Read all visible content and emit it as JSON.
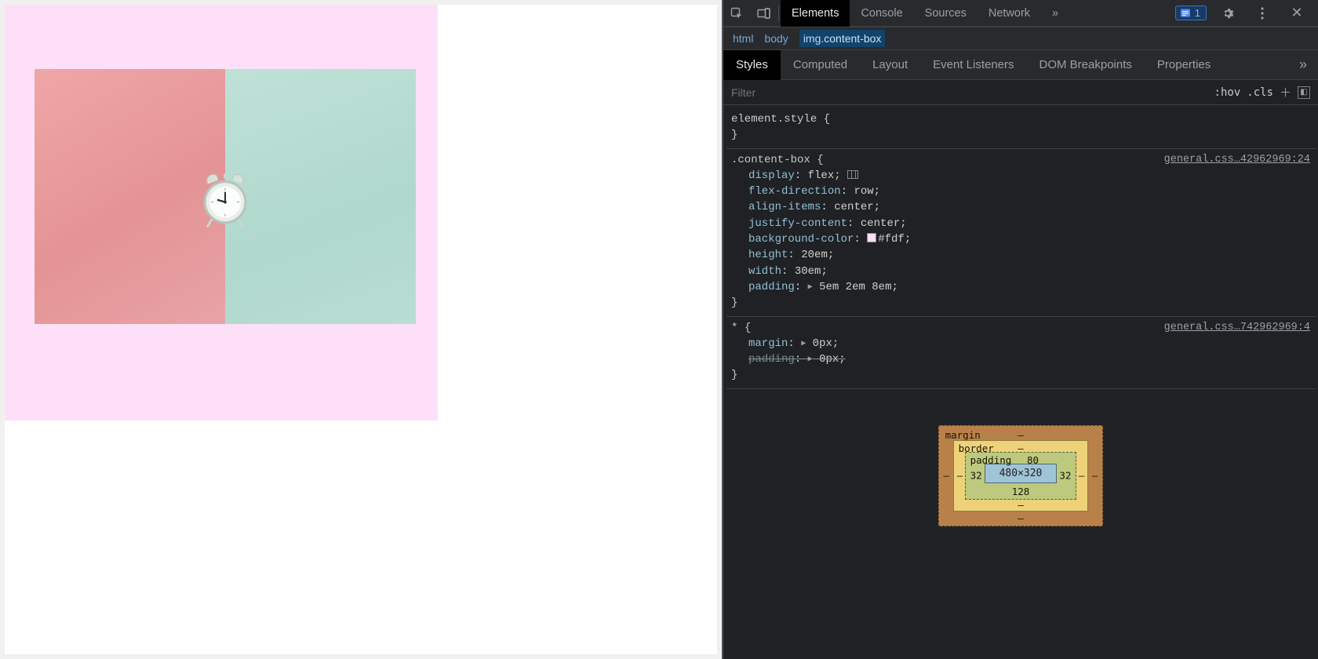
{
  "toolbar": {
    "tabs": [
      "Elements",
      "Console",
      "Sources",
      "Network"
    ],
    "active_tab": "Elements",
    "issues_count": "1"
  },
  "breadcrumbs": [
    {
      "tag": "html",
      "cls": ""
    },
    {
      "tag": "body",
      "cls": ""
    },
    {
      "tag": "img",
      "cls": ".content-box"
    }
  ],
  "subtabs": [
    "Styles",
    "Computed",
    "Layout",
    "Event Listeners",
    "DOM Breakpoints",
    "Properties"
  ],
  "active_subtab": "Styles",
  "filter": {
    "placeholder": "Filter",
    "hov": ":hov",
    "cls": ".cls"
  },
  "rules": {
    "element_style_selector": "element.style",
    "content_box": {
      "selector": ".content-box",
      "source": "general.css…42962969:24",
      "decls": [
        {
          "prop": "display",
          "val": "flex",
          "flex_icon": true
        },
        {
          "prop": "flex-direction",
          "val": "row"
        },
        {
          "prop": "align-items",
          "val": "center"
        },
        {
          "prop": "justify-content",
          "val": "center"
        },
        {
          "prop": "background-color",
          "val": "#fdf",
          "swatch": true
        },
        {
          "prop": "height",
          "val": "20em"
        },
        {
          "prop": "width",
          "val": "30em"
        },
        {
          "prop": "padding",
          "val": "5em 2em 8em",
          "expand": true
        }
      ]
    },
    "universal": {
      "selector": "*",
      "source": "general.css…742962969:4",
      "decls": [
        {
          "prop": "margin",
          "val": "0px",
          "expand": true
        },
        {
          "prop": "padding",
          "val": "0px",
          "expand": true,
          "overridden": true
        }
      ]
    }
  },
  "box_model": {
    "margin_label": "margin",
    "border_label": "border",
    "padding_label": "padding",
    "padding_top": "80",
    "padding_right": "32",
    "padding_bottom": "128",
    "padding_left": "32",
    "content_dims": "480×320",
    "dash": "–"
  }
}
